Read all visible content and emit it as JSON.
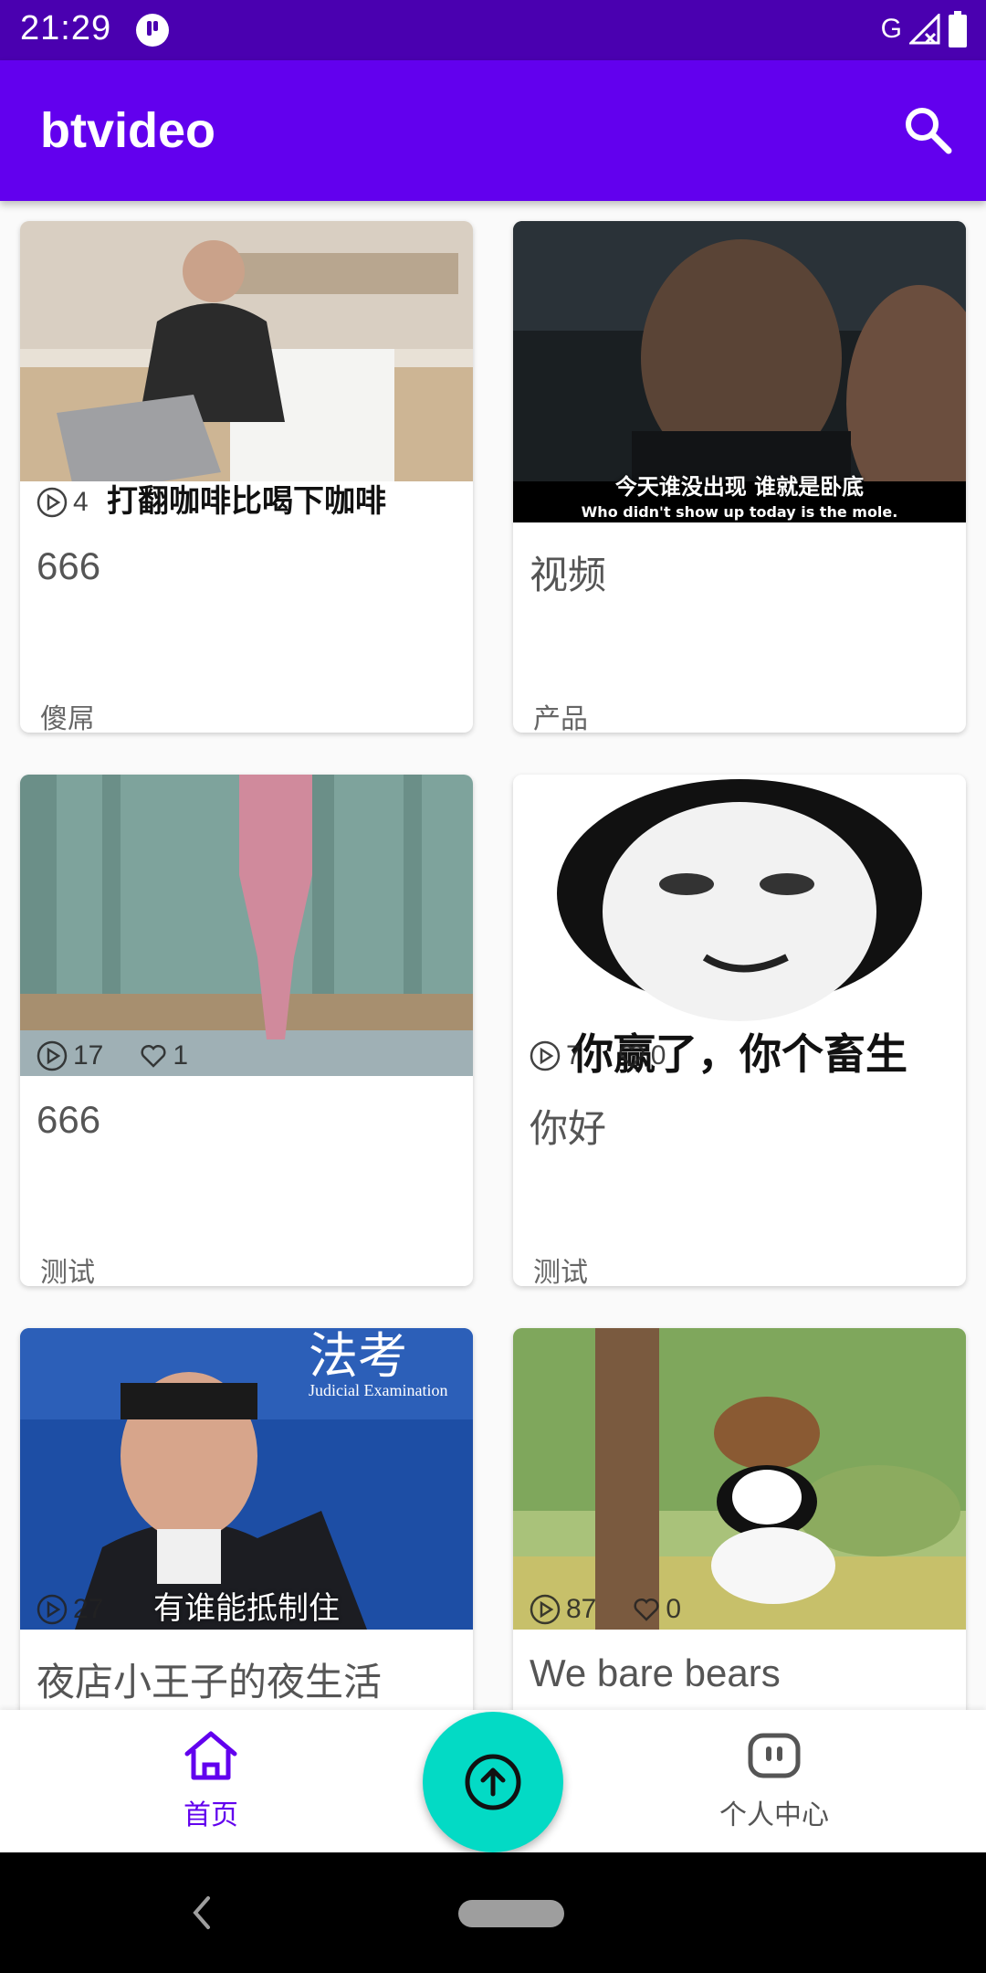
{
  "status_bar": {
    "time": "21:29",
    "network": "G"
  },
  "app_bar": {
    "title": "btvideo"
  },
  "cards": [
    {
      "title": "666",
      "tag": "傻屌",
      "caption": "打翻咖啡比喝下咖啡",
      "plays": "4",
      "likes": ""
    },
    {
      "title": "视频",
      "tag": "产品",
      "caption": "今天谁没出现 谁就是卧底",
      "caption_en": "Who didn't show up today is the mole."
    },
    {
      "title": "666",
      "tag": "测试",
      "plays": "17",
      "likes": "1"
    },
    {
      "title": "你好",
      "tag": "测试",
      "caption": "你赢了，你个畜生",
      "plays": "7",
      "likes": "0"
    },
    {
      "title": "夜店小王子的夜生活",
      "tag": "",
      "caption": "有谁能抵制住",
      "plays": "27",
      "likes": "",
      "banner": "法考",
      "banner_en": "Judicial Examination"
    },
    {
      "title": "We bare bears",
      "tag": "",
      "plays": "87",
      "likes": "0"
    }
  ],
  "bottom_nav": {
    "home_label": "首页",
    "profile_label": "个人中心"
  },
  "colors": {
    "primary": "#6200ee",
    "status": "#4a00b0",
    "fab": "#03dac5"
  },
  "icons": {
    "search": "search-icon",
    "home": "home-icon",
    "upload": "upload-icon",
    "profile": "profile-icon",
    "play": "play-icon",
    "like": "heart-icon"
  }
}
